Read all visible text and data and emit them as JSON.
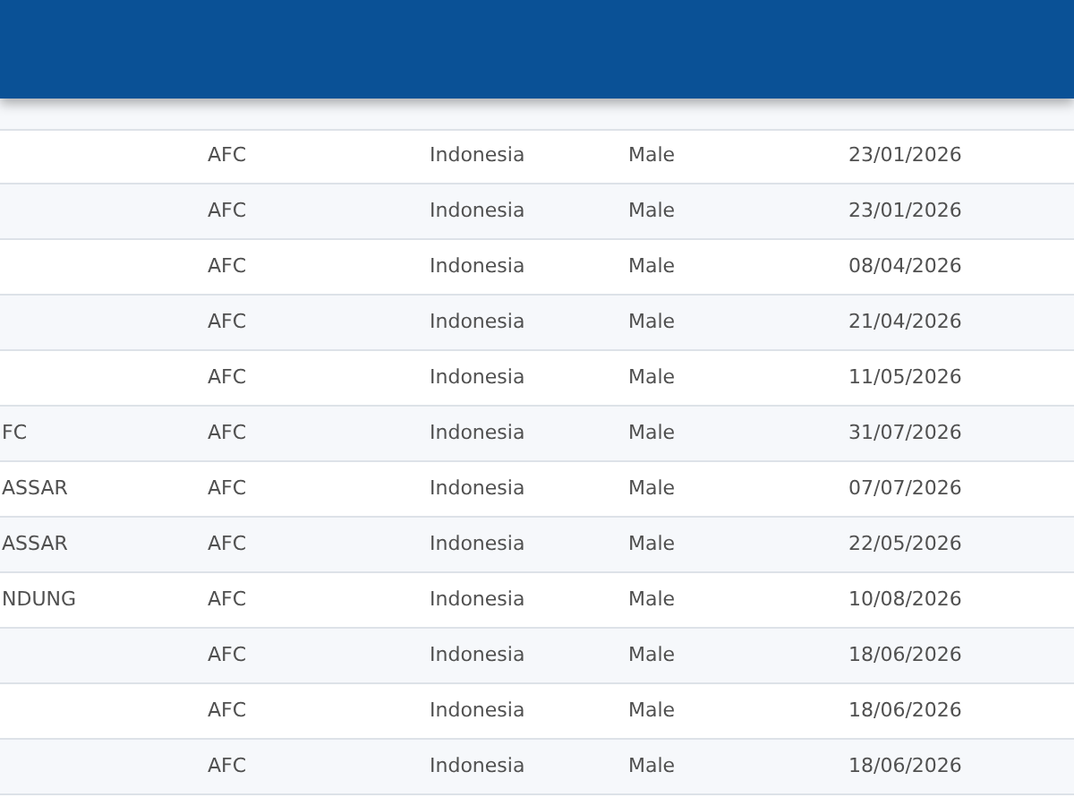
{
  "header": {
    "kind": "bar"
  },
  "table": {
    "rows": [
      {
        "column_1": "",
        "confederation": "AFC",
        "country": "Indonesia",
        "gender": "Male",
        "date": "23/01/2026"
      },
      {
        "column_1": "",
        "confederation": "AFC",
        "country": "Indonesia",
        "gender": "Male",
        "date": "23/01/2026"
      },
      {
        "column_1": "",
        "confederation": "AFC",
        "country": "Indonesia",
        "gender": "Male",
        "date": "08/04/2026"
      },
      {
        "column_1": "",
        "confederation": "AFC",
        "country": "Indonesia",
        "gender": "Male",
        "date": "21/04/2026"
      },
      {
        "column_1": "",
        "confederation": "AFC",
        "country": "Indonesia",
        "gender": "Male",
        "date": "11/05/2026"
      },
      {
        "column_1": "FC",
        "confederation": "AFC",
        "country": "Indonesia",
        "gender": "Male",
        "date": "31/07/2026"
      },
      {
        "column_1": "ASSAR",
        "confederation": "AFC",
        "country": "Indonesia",
        "gender": "Male",
        "date": "07/07/2026"
      },
      {
        "column_1": "ASSAR",
        "confederation": "AFC",
        "country": "Indonesia",
        "gender": "Male",
        "date": "22/05/2026"
      },
      {
        "column_1": "NDUNG",
        "confederation": "AFC",
        "country": "Indonesia",
        "gender": "Male",
        "date": "10/08/2026"
      },
      {
        "column_1": "",
        "confederation": "AFC",
        "country": "Indonesia",
        "gender": "Male",
        "date": "18/06/2026"
      },
      {
        "column_1": "",
        "confederation": "AFC",
        "country": "Indonesia",
        "gender": "Male",
        "date": "18/06/2026"
      },
      {
        "column_1": "",
        "confederation": "AFC",
        "country": "Indonesia",
        "gender": "Male",
        "date": "18/06/2026"
      }
    ]
  }
}
